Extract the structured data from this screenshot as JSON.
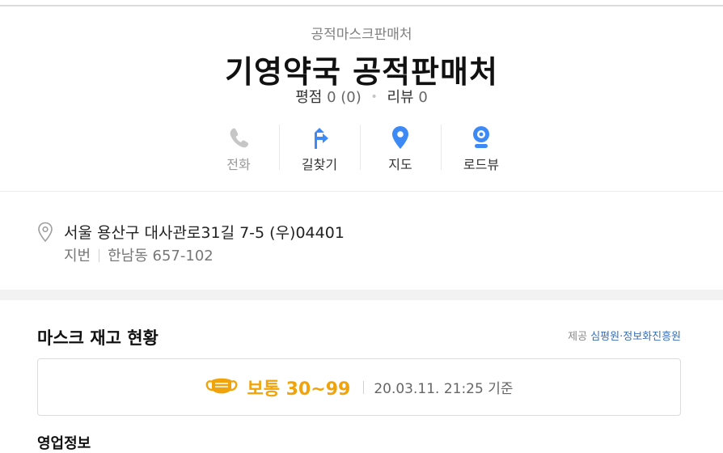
{
  "place": {
    "category": "공적마스크판매처",
    "name": "기영약국 공적판매처",
    "rating_label": "평점",
    "rating_value": "0 (0)",
    "review_label": "리뷰",
    "review_count": "0"
  },
  "actions": [
    {
      "label": "전화",
      "icon": "phone-icon",
      "enabled": false
    },
    {
      "label": "길찾기",
      "icon": "directions-icon",
      "enabled": true
    },
    {
      "label": "지도",
      "icon": "map-pin-icon",
      "enabled": true
    },
    {
      "label": "로드뷰",
      "icon": "roadview-icon",
      "enabled": true
    }
  ],
  "address": {
    "road": "서울 용산구 대사관로31길 7-5 (우)04401",
    "jibun_label": "지번",
    "jibun": "한남동 657-102"
  },
  "mask": {
    "section_title": "마스크 재고 현황",
    "provider_prefix": "제공",
    "provider_name": "심평원·정보화진흥원",
    "status": "보통 30~99",
    "timestamp": "20.03.11. 21:25 기준",
    "status_color": "#f0a30a"
  },
  "next_section_title": "영업정보"
}
